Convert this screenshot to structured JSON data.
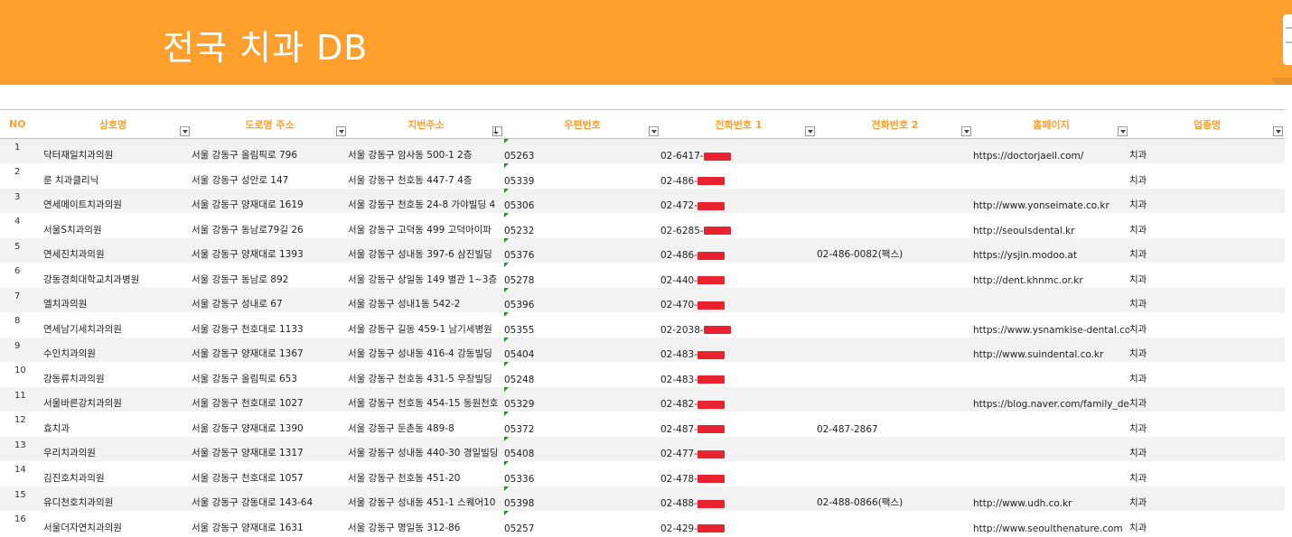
{
  "banner": {
    "title": "전국 치과 DB"
  },
  "colors": {
    "accent": "#FF9F2E",
    "stripe": "#F2F2F2",
    "redaction": "#E8232F",
    "comment_marker": "#2E8B2E"
  },
  "columns": [
    {
      "key": "no",
      "label": "NO"
    },
    {
      "key": "name",
      "label": "상호명"
    },
    {
      "key": "road",
      "label": "도로명 주소"
    },
    {
      "key": "lot",
      "label": "지번주소"
    },
    {
      "key": "zip",
      "label": "우편번호"
    },
    {
      "key": "phone1",
      "label": "전화번호 1"
    },
    {
      "key": "phone2",
      "label": "전화번호 2"
    },
    {
      "key": "web",
      "label": "홈페이지"
    },
    {
      "key": "type",
      "label": "업종명"
    }
  ],
  "rows": [
    {
      "no": "1",
      "name": "닥터재일치과의원",
      "road": "서울 강동구 올림픽로 796",
      "lot": "서울 강동구 암사동 500-1 2층",
      "zip": "05263",
      "phone1": "02-6417-",
      "phone2": "",
      "web": "https://doctorjaeil.com/",
      "type": "치과"
    },
    {
      "no": "2",
      "name": "룬 치과클리닉",
      "road": "서울 강동구 성안로 147",
      "lot": "서울 강동구 천호동 447-7 4층",
      "zip": "05339",
      "phone1": "02-486-",
      "phone2": "",
      "web": "",
      "type": "치과"
    },
    {
      "no": "3",
      "name": "연세메이트치과의원",
      "road": "서울 강동구 양재대로 1619",
      "lot": "서울 강동구 천호동 24-8 가야빌딩 4",
      "zip": "05306",
      "phone1": "02-472-",
      "phone2": "",
      "web": "http://www.yonseimate.co.kr",
      "type": "치과"
    },
    {
      "no": "4",
      "name": "서울S치과의원",
      "road": "서울 강동구 동남로79길 26",
      "lot": "서울 강동구 고덕동 499 고덕아이파",
      "zip": "05232",
      "phone1": "02-6285-",
      "phone2": "",
      "web": "http://seoulsdental.kr",
      "type": "치과"
    },
    {
      "no": "5",
      "name": "연세진치과의원",
      "road": "서울 강동구 양재대로 1393",
      "lot": "서울 강동구 성내동 397-6 삼진빌딩",
      "zip": "05376",
      "phone1": "02-486-",
      "phone2": "02-486-0082(팩스)",
      "web": "https://ysjin.modoo.at",
      "type": "치과"
    },
    {
      "no": "6",
      "name": "강동경희대학교치과병원",
      "road": "서울 강동구 동남로 892",
      "lot": "서울 강동구 상일동 149 별관 1~3층",
      "zip": "05278",
      "phone1": "02-440-",
      "phone2": "",
      "web": "http://dent.khnmc.or.kr",
      "type": "치과"
    },
    {
      "no": "7",
      "name": "엘치과의원",
      "road": "서울 강동구 성내로 67",
      "lot": "서울 강동구 성내1동 542-2",
      "zip": "05396",
      "phone1": "02-470-",
      "phone2": "",
      "web": "",
      "type": "치과"
    },
    {
      "no": "8",
      "name": "연세남기세치과의원",
      "road": "서울 강동구 천호대로 1133",
      "lot": "서울 강동구 길동 459-1 남기세병원",
      "zip": "05355",
      "phone1": "02-2038-",
      "phone2": "",
      "web": "https://www.ysnamkise-dental.co.kr",
      "type": "치과"
    },
    {
      "no": "9",
      "name": "수인치과의원",
      "road": "서울 강동구 양재대로 1367",
      "lot": "서울 강동구 성내동 416-4 강동빌딩",
      "zip": "05404",
      "phone1": "02-483-",
      "phone2": "",
      "web": "http://www.suindental.co.kr",
      "type": "치과"
    },
    {
      "no": "10",
      "name": "강동류치과의원",
      "road": "서울 강동구 올림픽로 653",
      "lot": "서울 강동구 천호동 431-5 우창빌딩",
      "zip": "05248",
      "phone1": "02-483-",
      "phone2": "",
      "web": "",
      "type": "치과"
    },
    {
      "no": "11",
      "name": "서울바른강치과의원",
      "road": "서울 강동구 천호대로 1027",
      "lot": "서울 강동구 천호동 454-15 동원천호",
      "zip": "05329",
      "phone1": "02-482-",
      "phone2": "",
      "web": "https://blog.naver.com/family_denta",
      "type": "치과"
    },
    {
      "no": "12",
      "name": "효치과",
      "road": "서울 강동구 양재대로 1390",
      "lot": "서울 강동구 둔촌동 489-8",
      "zip": "05372",
      "phone1": "02-487-",
      "phone2": "02-487-2867",
      "web": "",
      "type": "치과"
    },
    {
      "no": "13",
      "name": "우리치과의원",
      "road": "서울 강동구 양재대로 1317",
      "lot": "서울 강동구 성내동 440-30 경일빌딩",
      "zip": "05408",
      "phone1": "02-477-",
      "phone2": "",
      "web": "",
      "type": "치과"
    },
    {
      "no": "14",
      "name": "김진호치과의원",
      "road": "서울 강동구 천호대로 1057",
      "lot": "서울 강동구 천호동 451-20",
      "zip": "05336",
      "phone1": "02-478-",
      "phone2": "",
      "web": "",
      "type": "치과"
    },
    {
      "no": "15",
      "name": "유디천호치과의원",
      "road": "서울 강동구 강동대로 143-64",
      "lot": "서울 강동구 성내동 451-1 스퀘어10",
      "zip": "05398",
      "phone1": "02-488-",
      "phone2": "02-488-0866(팩스)",
      "web": "http://www.udh.co.kr",
      "type": "치과"
    },
    {
      "no": "16",
      "name": "서울더자연치과의원",
      "road": "서울 강동구 양재대로 1631",
      "lot": "서울 강동구 명일동 312-86",
      "zip": "05257",
      "phone1": "02-429-",
      "phone2": "",
      "web": "http://www.seoulthenature.com",
      "type": "치과"
    }
  ]
}
